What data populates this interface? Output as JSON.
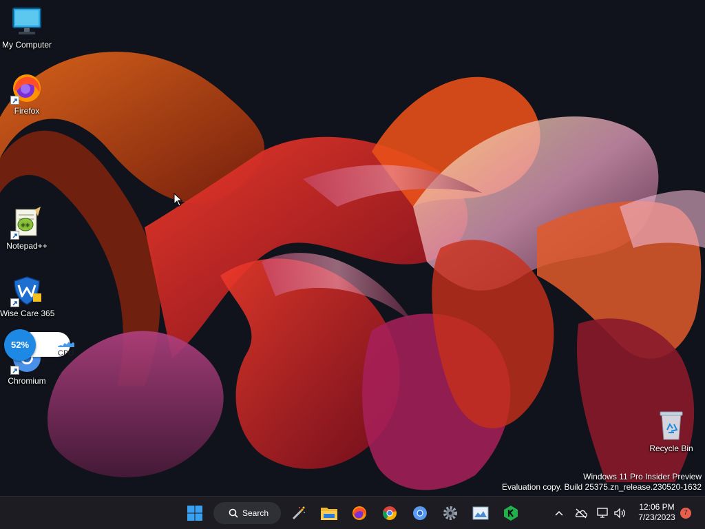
{
  "desktop": {
    "icons": [
      {
        "label": "My Computer",
        "icon": "monitor-icon"
      },
      {
        "label": "Firefox",
        "icon": "firefox-icon"
      },
      {
        "label": "Notepad++",
        "icon": "notepad-plus-plus-icon"
      },
      {
        "label": "Wise Care 365",
        "icon": "wise-care-shield-icon"
      },
      {
        "label": "Chromium",
        "icon": "chromium-icon"
      },
      {
        "label": "Recycle Bin",
        "icon": "recycle-bin-icon"
      }
    ],
    "cpu_widget": {
      "percent_text": "52%",
      "percent": 52,
      "label": "CPU"
    },
    "watermark": {
      "line1": "Windows 11 Pro Insider Preview",
      "line2": "Evaluation copy. Build 25375.zn_release.230520-1632"
    }
  },
  "taskbar": {
    "search_label": "Search",
    "pinned": [
      "windows-start-icon",
      "magic-wand-icon",
      "file-explorer-icon",
      "firefox-icon",
      "chrome-icon",
      "chromium-icon",
      "settings-icon",
      "photos-icon",
      "k-app-icon"
    ],
    "tray": {
      "icons": [
        "chevron-up-icon",
        "cloud-offline-icon",
        "network-icon",
        "volume-icon"
      ],
      "time": "12:06 PM",
      "date": "7/23/2023",
      "notification_count": "7"
    }
  },
  "colors": {
    "taskbar_bg": "#1c1c22",
    "wallpaper_bg": "#0f121b",
    "cpu_accent": "#1e88e5",
    "badge": "#e8604c"
  }
}
